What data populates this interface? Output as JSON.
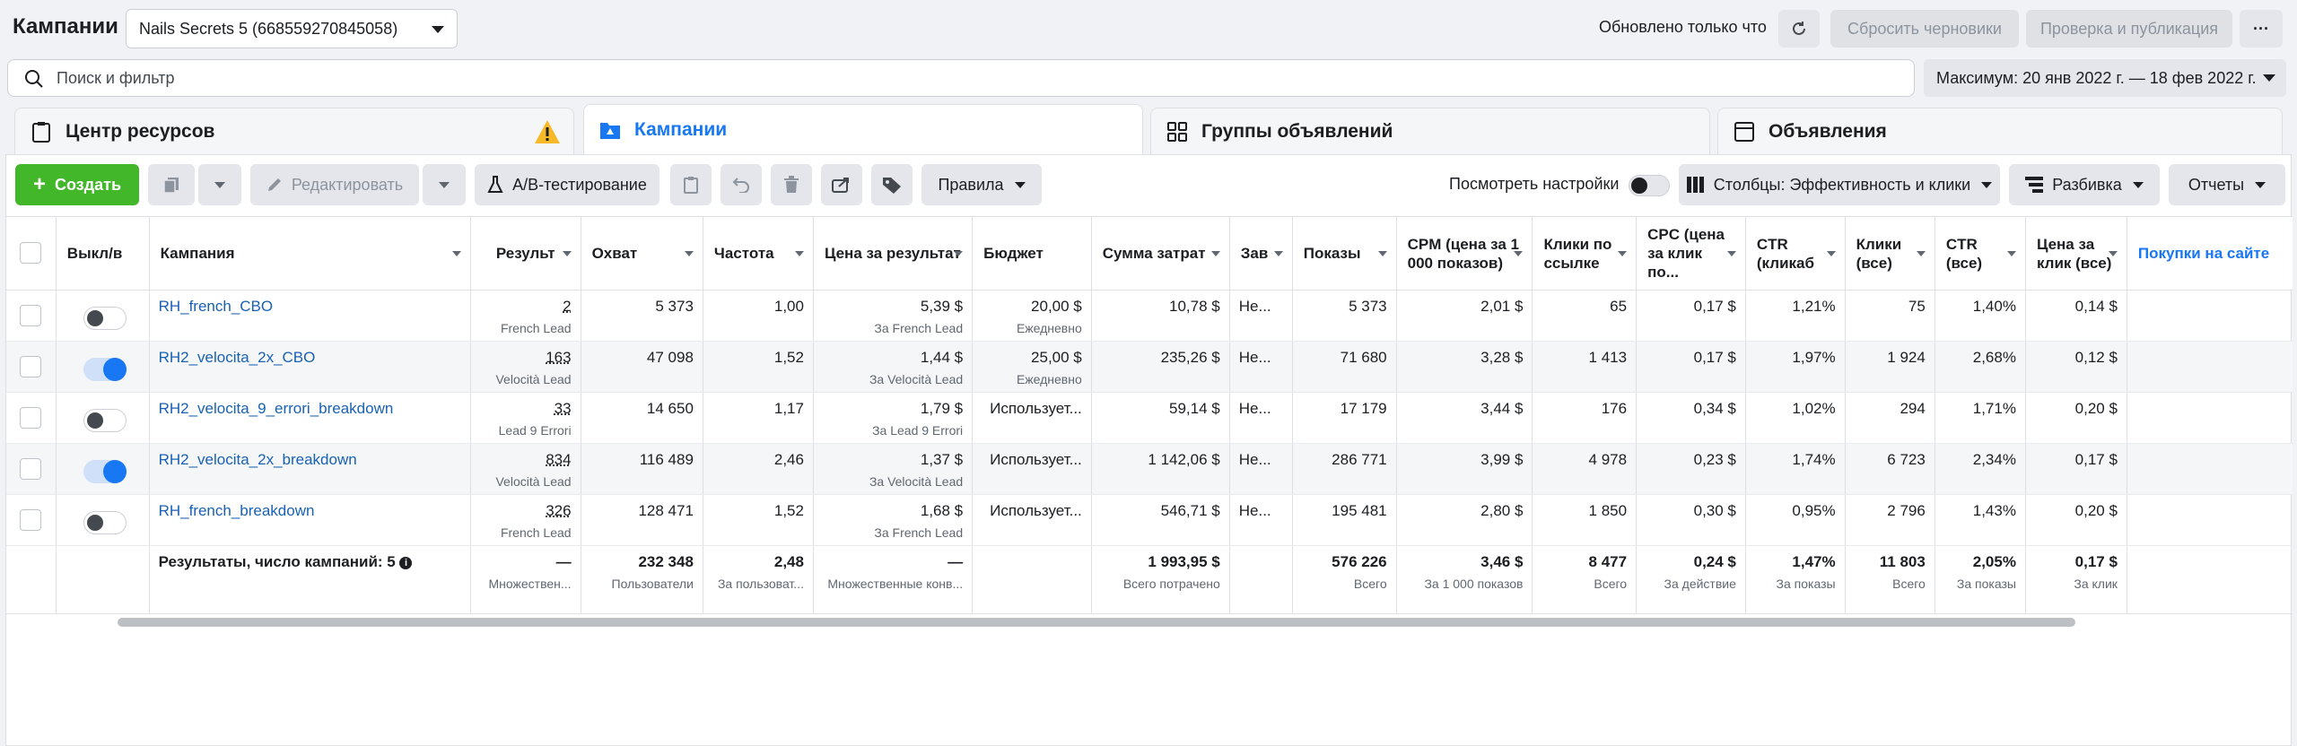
{
  "header": {
    "title": "Кампании",
    "account": "Nails Secrets 5 (668559270845058)",
    "updated": "Обновлено только что",
    "discard": "Сбросить черновики",
    "review": "Проверка и публикация",
    "more": "···"
  },
  "search": {
    "placeholder": "Поиск и фильтр"
  },
  "date_range": "Максимум: 20 янв 2022 г. — 18 фев 2022 г.",
  "tabs": [
    {
      "label": "Центр ресурсов"
    },
    {
      "label": "Кампании"
    },
    {
      "label": "Группы объявлений"
    },
    {
      "label": "Объявления"
    }
  ],
  "toolbar": {
    "create": "Создать",
    "edit": "Редактировать",
    "ab_test": "A/B-тестирование",
    "rules": "Правила",
    "view_settings": "Посмотреть настройки",
    "columns": "Столбцы: Эффективность и клики",
    "breakdown": "Разбивка",
    "reports": "Отчеты"
  },
  "columns": [
    "Выкл/в",
    "Кампания",
    "Результ",
    "Охват",
    "Частота",
    "Цена за результат",
    "Бюджет",
    "Сумма затрат",
    "Зав",
    "Показы",
    "CPM (цена за 1 000 показов)",
    "Клики по ссылке",
    "CPC (цена за клик по...",
    "CTR (кликаб",
    "Клики (все)",
    "CTR (все)",
    "Цена за клик (все)",
    "Покупки на сайте"
  ],
  "rows": [
    {
      "on": false,
      "name": "RH_french_CBO",
      "results": "2",
      "results_sub": "French Lead",
      "reach": "5 373",
      "freq": "1,00",
      "cpr": "5,39 $",
      "cpr_sub": "За French Lead",
      "budget": "20,00 $",
      "budget_sub": "Ежедневно",
      "spend": "10,78 $",
      "end": "Не...",
      "impr": "5 373",
      "cpm": "2,01 $",
      "link_clicks": "65",
      "cpc": "0,17 $",
      "ctr": "1,21%",
      "clicks_all": "75",
      "ctr_all": "1,40%",
      "cpc_all": "0,14 $"
    },
    {
      "on": true,
      "name": "RH2_velocita_2x_CBO",
      "results": "163",
      "results_sub": "Velocità Lead",
      "reach": "47 098",
      "freq": "1,52",
      "cpr": "1,44 $",
      "cpr_sub": "За Velocità Lead",
      "budget": "25,00 $",
      "budget_sub": "Ежедневно",
      "spend": "235,26 $",
      "end": "Не...",
      "impr": "71 680",
      "cpm": "3,28 $",
      "link_clicks": "1 413",
      "cpc": "0,17 $",
      "ctr": "1,97%",
      "clicks_all": "1 924",
      "ctr_all": "2,68%",
      "cpc_all": "0,12 $"
    },
    {
      "on": false,
      "name": "RH2_velocita_9_errori_breakdown",
      "results": "33",
      "results_sub": "Lead 9 Errori",
      "reach": "14 650",
      "freq": "1,17",
      "cpr": "1,79 $",
      "cpr_sub": "За Lead 9 Errori",
      "budget": "Использует...",
      "budget_sub": "",
      "spend": "59,14 $",
      "end": "Не...",
      "impr": "17 179",
      "cpm": "3,44 $",
      "link_clicks": "176",
      "cpc": "0,34 $",
      "ctr": "1,02%",
      "clicks_all": "294",
      "ctr_all": "1,71%",
      "cpc_all": "0,20 $"
    },
    {
      "on": true,
      "name": "RH2_velocita_2x_breakdown",
      "results": "834",
      "results_sub": "Velocità Lead",
      "reach": "116 489",
      "freq": "2,46",
      "cpr": "1,37 $",
      "cpr_sub": "За Velocità Lead",
      "budget": "Использует...",
      "budget_sub": "",
      "spend": "1 142,06 $",
      "end": "Не...",
      "impr": "286 771",
      "cpm": "3,99 $",
      "link_clicks": "4 978",
      "cpc": "0,23 $",
      "ctr": "1,74%",
      "clicks_all": "6 723",
      "ctr_all": "2,34%",
      "cpc_all": "0,17 $"
    },
    {
      "on": false,
      "name": "RH_french_breakdown",
      "results": "326",
      "results_sub": "French Lead",
      "reach": "128 471",
      "freq": "1,52",
      "cpr": "1,68 $",
      "cpr_sub": "За French Lead",
      "budget": "Использует...",
      "budget_sub": "",
      "spend": "546,71 $",
      "end": "Не...",
      "impr": "195 481",
      "cpm": "2,80 $",
      "link_clicks": "1 850",
      "cpc": "0,30 $",
      "ctr": "0,95%",
      "clicks_all": "2 796",
      "ctr_all": "1,43%",
      "cpc_all": "0,20 $"
    }
  ],
  "totals": {
    "label": "Результаты, число кампаний: 5",
    "results": "—",
    "results_sub": "Множествен...",
    "reach": "232 348",
    "reach_sub": "Пользователи",
    "freq": "2,48",
    "freq_sub": "За пользоват...",
    "cpr": "—",
    "cpr_sub": "Множественные конв...",
    "spend": "1 993,95 $",
    "spend_sub": "Всего потрачено",
    "impr": "576 226",
    "impr_sub": "Всего",
    "cpm": "3,46 $",
    "cpm_sub": "За 1 000 показов",
    "link_clicks": "8 477",
    "link_clicks_sub": "Всего",
    "cpc": "0,24 $",
    "cpc_sub": "За действие",
    "ctr": "1,47%",
    "ctr_sub": "За показы",
    "clicks_all": "11 803",
    "clicks_all_sub": "Всего",
    "ctr_all": "2,05%",
    "ctr_all_sub": "За показы",
    "cpc_all": "0,17 $",
    "cpc_all_sub": "За клик"
  },
  "colors": {
    "accent": "#1877f2",
    "create": "#42b72a",
    "warning": "#f7b928",
    "link": "#1861b5"
  }
}
